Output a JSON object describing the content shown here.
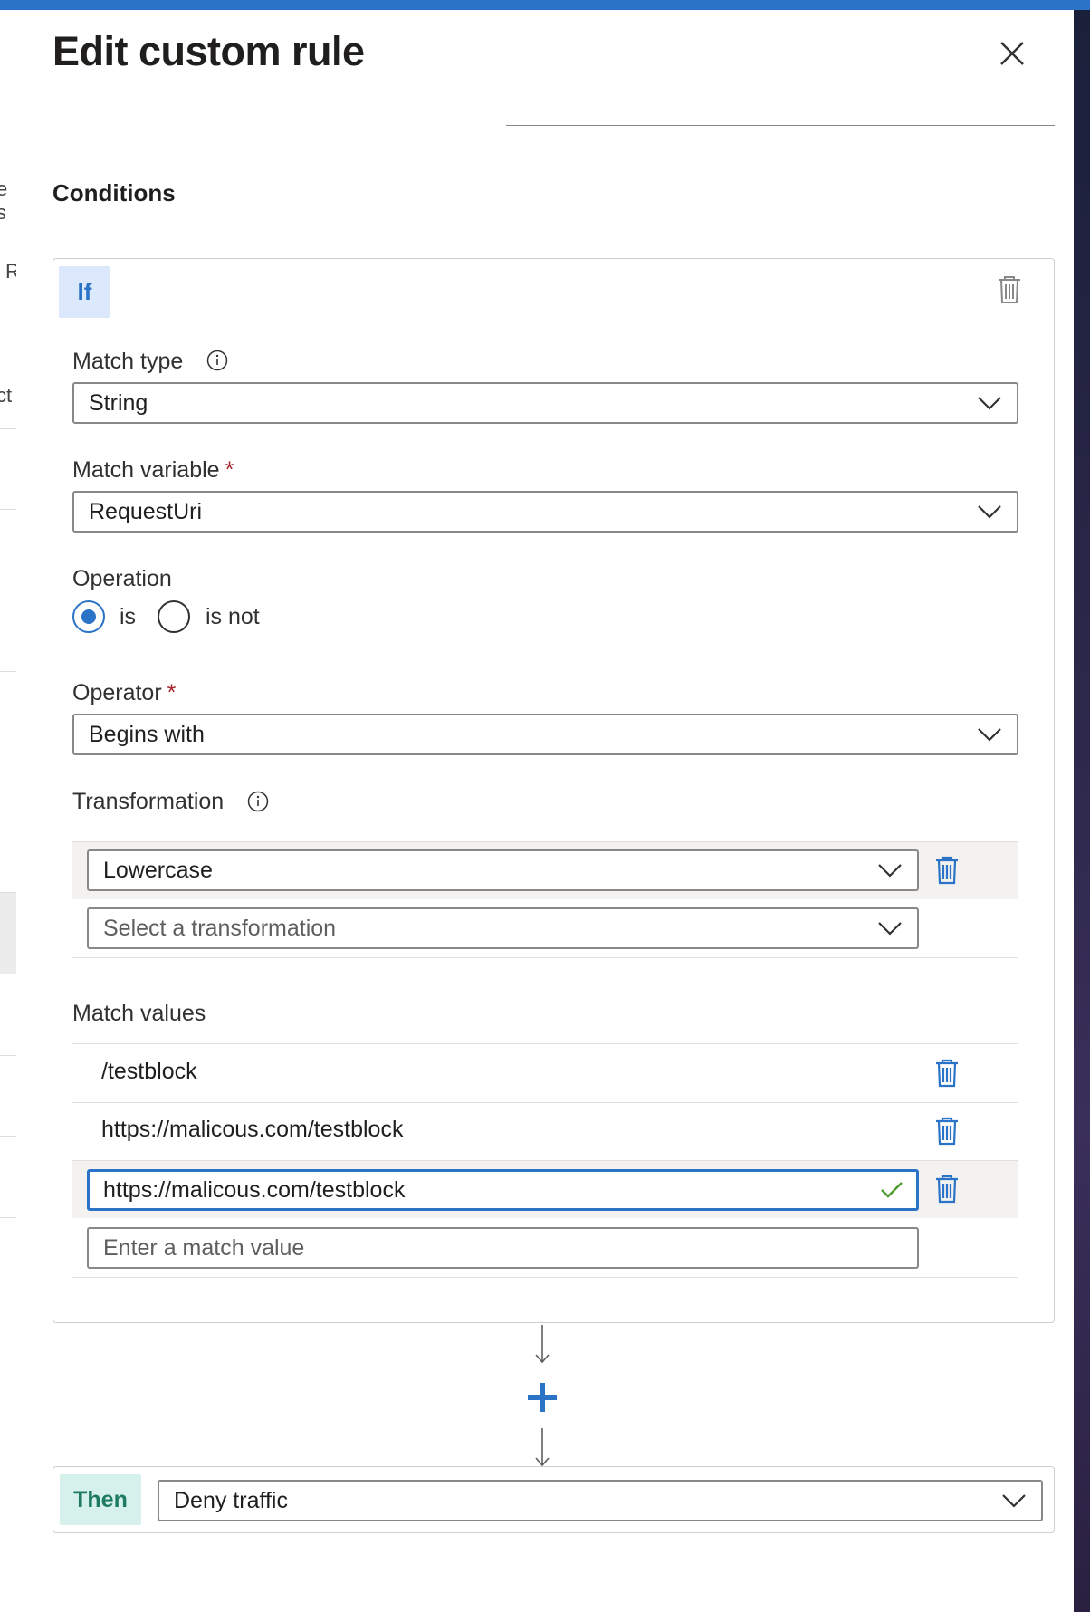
{
  "panel": {
    "title": "Edit custom rule",
    "section_title": "Conditions"
  },
  "condition": {
    "if_label": "If",
    "match_type": {
      "label": "Match type",
      "value": "String"
    },
    "match_variable": {
      "label": "Match variable",
      "required_mark": "*",
      "value": "RequestUri"
    },
    "operation": {
      "label": "Operation",
      "options": [
        "is",
        "is not"
      ],
      "selected": "is"
    },
    "operator": {
      "label": "Operator",
      "required_mark": "*",
      "value": "Begins with"
    },
    "transformation": {
      "label": "Transformation",
      "items": [
        "Lowercase"
      ],
      "placeholder": "Select a transformation"
    },
    "match_values": {
      "label": "Match values",
      "items": [
        "/testblock",
        "https://malicous.com/testblock"
      ],
      "editing_value": "https://malicous.com/testblock",
      "placeholder": "Enter a match value"
    }
  },
  "action": {
    "then_label": "Then",
    "value": "Deny traffic"
  },
  "colors": {
    "accent": "#2b73c7",
    "then_bg": "#d6f1ec",
    "if_bg": "#dce8fb",
    "required": "#a4262c"
  }
}
